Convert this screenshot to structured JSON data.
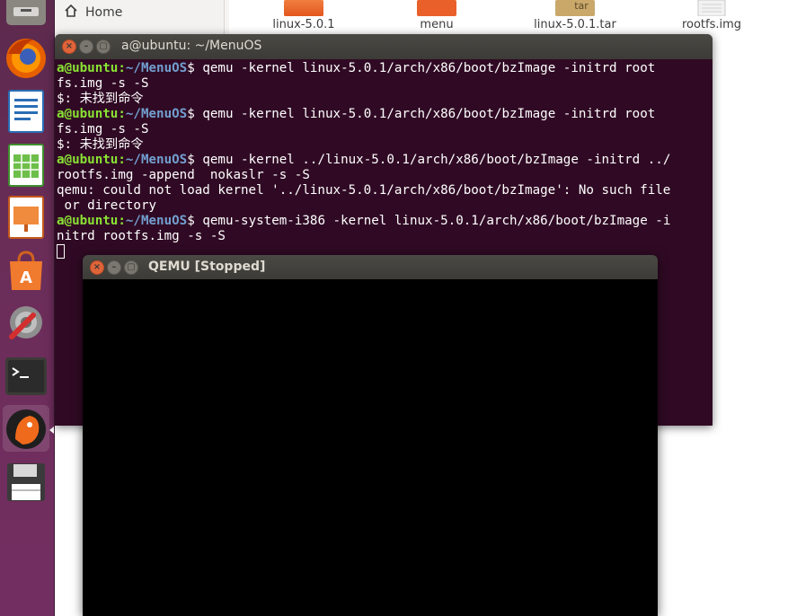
{
  "file_manager": {
    "sidebar_home": "Home",
    "files": [
      {
        "name": "linux-5.0.1",
        "icon": "folder-icon"
      },
      {
        "name": "menu",
        "icon": "folder-icon"
      },
      {
        "name": "linux-5.0.1.tar",
        "icon": "archive-icon",
        "badge": "tar"
      },
      {
        "name": "rootfs.img",
        "icon": "file-icon"
      }
    ]
  },
  "terminal": {
    "title": "a@ubuntu: ~/MenuOS",
    "prompt_user": "a@ubuntu",
    "prompt_sep": ":",
    "prompt_path": "~/MenuOS",
    "prompt_end": "$ ",
    "lines": [
      {
        "type": "prompt",
        "text": "qemu -kernel linux-5.0.1/arch/x86/boot/bzImage -initrd root"
      },
      {
        "type": "out",
        "text": "fs.img -s -S"
      },
      {
        "type": "out",
        "text": "$: 未找到命令"
      },
      {
        "type": "prompt",
        "text": "qemu -kernel linux-5.0.1/arch/x86/boot/bzImage -initrd root"
      },
      {
        "type": "out",
        "text": "fs.img -s -S"
      },
      {
        "type": "out",
        "text": "$: 未找到命令"
      },
      {
        "type": "prompt",
        "text": "qemu -kernel ../linux-5.0.1/arch/x86/boot/bzImage -initrd ../"
      },
      {
        "type": "out",
        "text": "rootfs.img -append  nokaslr -s -S"
      },
      {
        "type": "out",
        "text": "qemu: could not load kernel '../linux-5.0.1/arch/x86/boot/bzImage': No such file"
      },
      {
        "type": "out",
        "text": " or directory"
      },
      {
        "type": "prompt",
        "text": "qemu-system-i386 -kernel linux-5.0.1/arch/x86/boot/bzImage -i"
      },
      {
        "type": "out",
        "text": "nitrd rootfs.img -s -S"
      }
    ]
  },
  "qemu": {
    "title": "QEMU [Stopped]"
  },
  "launcher": {
    "items": [
      "files-icon",
      "firefox-icon",
      "writer-icon",
      "calc-icon",
      "impress-icon",
      "software-center-icon",
      "settings-icon",
      "terminal-icon",
      "qemu-icon",
      "save-icon"
    ]
  },
  "colors": {
    "terminal_bg": "#300a24",
    "prompt_user": "#8ae234",
    "prompt_path": "#729fcf",
    "launcher_bg": "#6a2d58"
  }
}
